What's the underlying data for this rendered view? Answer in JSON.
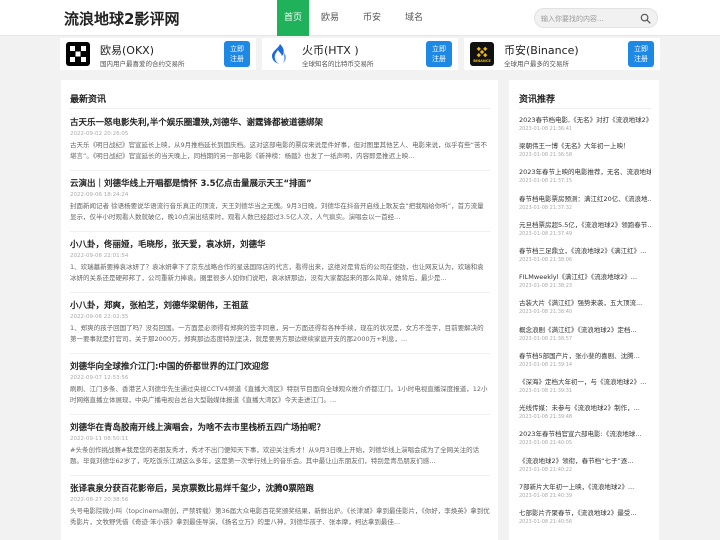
{
  "site": {
    "title": "流浪地球2影评网"
  },
  "nav": [
    "首页",
    "欧易",
    "币安",
    "域名"
  ],
  "search": {
    "placeholder": "输入你要找的内容..."
  },
  "exchanges": [
    {
      "name": "欧易(OKX)",
      "desc": "国内用户最喜爱的合约交易所",
      "button": [
        "立即",
        "注册"
      ],
      "icon": "okx-logo-icon",
      "color": "#111111"
    },
    {
      "name": "火币(HTX )",
      "desc": "全球知名的比特币交易所",
      "button": [
        "立即",
        "注册"
      ],
      "icon": "htx-logo-icon",
      "color": "#1e6bd6"
    },
    {
      "name": "币安(Binance)",
      "desc": "全球用户最多的交易所",
      "button": [
        "立即",
        "注册"
      ],
      "icon": "binance-logo-icon",
      "color": "#f0b90b",
      "logo_text": "BINANCE"
    }
  ],
  "main": {
    "section_title": "最新资讯",
    "articles": [
      {
        "title": "古天乐《明日战纪》官宣延长上映，从9月推档延长到国庆档。这对这部电影的票房来说是件好事，但对图里其他艺人、电影来说，似乎有些“苦不堪言”。《明日战纪》官宣延长的当天晚上，同档期的另一部电影《新神榜：杨戬》也发了一纸声明，内容即是推迟上映...",
        "display_title": "古天乐一怒电影失利,半个娱乐圈遭殃,刘德华、谢霆锋都被道德绑架",
        "time": "2022-09-02 20:26:05"
      },
      {
        "title": "云演出｜刘德华线上开唱都是情怀 3.5亿点击量展示天王“排面”",
        "time": "2022-09-06 18:24:24",
        "excerpt": "封面新闻记者 徐语杨要说华语流行音乐真正的顶流，天王刘德华当之无愧。9月3日晚，刘德华在抖音开启线上歌友会“把我唱给你听”，首方流量显示，仅半小时观看人数就破亿，晚10点演出结束时，观看人数已经超过3.5亿人次，人气疯实。演唱会以一首经..."
      },
      {
        "title": "小八卦，佟丽娅，毛晓彤，张天爱，袁冰妍，刘德华",
        "time": "2022-09-06 22:01:54",
        "excerpt": "1、欢瑞墓新要捧袁冰妍了？袁冰妍拿下了京东战略合作的星选国际店的代言，看得出来，这绝对是背后的公司在使劲，也让网友认为，欢瑞和袁冰妍的关系还是硬邦邦了，公司重新力捧袁。圈里很多人如你们说吧，袁冰妍那边，没有大家都起来的那么简单，她背后，最少是..."
      },
      {
        "title": "小八卦，郑爽，张柏芝，刘德华梁朝伟，王祖蓝",
        "time": "2022-09-06 22:02:35",
        "excerpt": "1、郑爽的孩子回国了吗？没有回国。一方面是必须得有郑爽的签字同意，另一方面还得有各种手续，现在的状况是，女方不签字，目前要解决的第一要事就是打官司，关于那2000万，郑爽那边态度特别坚决，就是要男方那边继续家庭开支的那2000万+利息，..."
      },
      {
        "title": "刘德华向全球推介江门:中国的侨都世界的江门欢迎您",
        "time": "2022-09-07 12:53:56",
        "excerpt": "刷刷、江门多条、香港艺人刘德华先生通过央视CCTV4频道《直播大湾区》特别节目面向全球观众推介侨都江门。1小时电视直播深度报道，12小时网络直播立体展现，中央广播电视台总台大型融媒体报道《直播大湾区》今天走进江门。..."
      },
      {
        "title": "刘德华在青岛胶南开线上演唱会，为啥不去市里栈桥五四广场拍呢？",
        "time": "2022-09-11 08:50:11",
        "excerpt": "#头条创作挑战赛#我是您的老朋友秀才，秀才不出门便知天下事，欢迎关注秀才！从9月3日晚上开始，刘德华线上演唱会成为了全网关注的话题。毕竟刘德华62岁了，吃吃饭乐江湖这么多年，这是第一次举行线上的音乐会。其中最让山东朋友们，特别是青岛朋友们感..."
      },
      {
        "title": "张译袁泉分获百花影帝后，吴京票数比易烊千玺少，沈腾0票陪跑",
        "time": "2022-08-27 20:38:56",
        "excerpt": "头号电影院微小叫（topcinema原创，严禁转载）第36届大众电影百花奖颁奖结果，新鲜出炉。《长津湖》拿到最佳影片，《你好，李焕英》拿到优秀影片，文牧野凭借《奇迹·笨小孩》拿到最佳导演，《扬名立万》的里八神，刘德华孩子、张本摩，柯达拿到最佳..."
      }
    ]
  },
  "side": {
    "section_title": "资讯推荐",
    "items": [
      {
        "title": "2023春节档电影,《无名》对打《流浪地球2》",
        "time": "2023-01-08 21:36:41"
      },
      {
        "title": "梁朝伟王一博《无名》大年初一上映！",
        "time": "2023-01-08 21:36:58"
      },
      {
        "title": "2023年春节上映的电影推荐，无名、流浪地球2",
        "time": "2023-01-08 21:37:15"
      },
      {
        "title": "春节档电影票房预测：满江红20亿、《流浪地...",
        "time": "2023-01-08 21:37:32"
      },
      {
        "title": "元旦档票房超5.5亿，《流浪地球2》领跑春节...",
        "time": "2023-01-08 21:37:49"
      },
      {
        "title": "春节档三足鼎立，《流浪地球2》《满江红》...",
        "time": "2023-01-08 21:38:06"
      },
      {
        "title": "FILMweeklyl《满江红》《流浪地球2》...",
        "time": "2023-01-08 21:38:23"
      },
      {
        "title": "古装大片《满江红》强势来袭，五大顶流...",
        "time": "2023-01-08 21:38:40"
      },
      {
        "title": "概念浪剧《满江红》《流浪地球2》定档...",
        "time": "2023-01-08 21:38:57"
      },
      {
        "title": "春节档5部国产片，张小斐的喜剧、沈腾...",
        "time": "2023-01-08 21:39:14"
      },
      {
        "title": "《深海》定档大年初一，与《流浪地球2》...",
        "time": "2023-01-08 21:39:31"
      },
      {
        "title": "光线传媒：未参与《流浪地球2》制作，...",
        "time": "2023-01-08 21:39:48"
      },
      {
        "title": "2023年春节档官宣六部电影:《流浪地球...",
        "time": "2023-01-08 21:40:05"
      },
      {
        "title": "《流浪地球2》领衔，春节档“七子”逐...",
        "time": "2023-01-08 21:40:22"
      },
      {
        "title": "7部新片大年初一上映，《流浪地球2》...",
        "time": "2023-01-08 21:40:39"
      },
      {
        "title": "七部影片齐聚春节，《流浪地球2》最受...",
        "time": "2023-01-08 21:40:56"
      }
    ]
  }
}
